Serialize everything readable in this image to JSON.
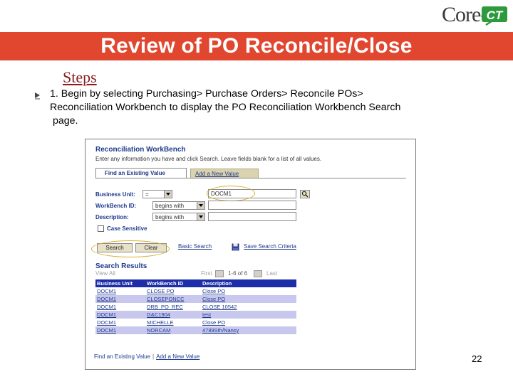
{
  "logo": {
    "text": "Core-",
    "mark": "CT",
    "mark_color": "#2e9a3e"
  },
  "banner": {
    "title": "Review of PO Reconcile/Close",
    "color": "#e1462f"
  },
  "steps_heading": "Steps",
  "step1": {
    "line1": "1. Begin by selecting Purchasing> Purchase Orders> Reconcile POs>",
    "line2": "Reconciliation Workbench to display the PO Reconciliation Workbench Search",
    "line3": "page."
  },
  "screenshot": {
    "title": "Reconciliation WorkBench",
    "instructions": "Enter any information you have and click Search. Leave fields blank for a list of all values.",
    "tabs": [
      {
        "label": "Find an Existing Value",
        "active": true
      },
      {
        "label": "Add a New Value",
        "active": false
      }
    ],
    "fields": {
      "business_unit": {
        "label": "Business Unit:",
        "operator": "=",
        "value": "DOCM1"
      },
      "workbench_id": {
        "label": "WorkBench ID:",
        "operator": "begins with",
        "value": ""
      },
      "description": {
        "label": "Description:",
        "operator": "begins with",
        "value": ""
      }
    },
    "case_sensitive": {
      "label": "Case Sensitive",
      "checked": false
    },
    "buttons": {
      "search": "Search",
      "clear": "Clear"
    },
    "links": {
      "basic_search": "Basic Search",
      "save_search": "Save Search Criteria"
    },
    "results": {
      "title": "Search Results",
      "view": "View All",
      "first": "First",
      "range": "1-6 of 6",
      "last": "Last",
      "columns": [
        "Business Unit",
        "WorkBench ID",
        "Description"
      ],
      "rows": [
        [
          "DOCM1",
          "CLOSE PO",
          "Close PO"
        ],
        [
          "DOCM1",
          "CLOSEPONCC",
          "Close PO"
        ],
        [
          "DOCM1",
          "DRB_PO_REC",
          "CLOSE 10542"
        ],
        [
          "DOCM1",
          "G&C1904",
          "test"
        ],
        [
          "DOCM1",
          "MICHELLE",
          "Close PO"
        ],
        [
          "DOCM1",
          "NORCAM",
          "4789Sth/Nancy"
        ]
      ]
    },
    "bottom_links": {
      "find": "Find an Existing Value",
      "add": "Add a New Value"
    }
  },
  "page_number": "22"
}
